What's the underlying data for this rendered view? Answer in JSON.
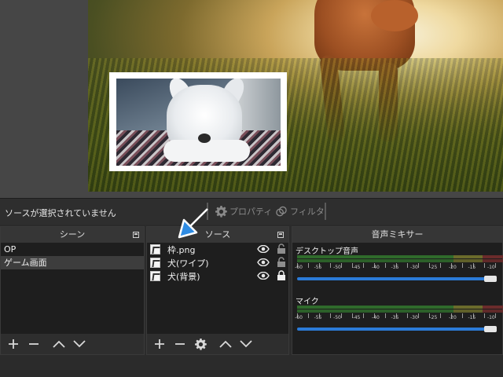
{
  "status": {
    "message": "ソースが選択されていません"
  },
  "toolbar": {
    "properties_label": "プロパティ",
    "filters_label": "フィルタ"
  },
  "scenes": {
    "title": "シーン",
    "items": [
      {
        "label": "OP",
        "selected": false
      },
      {
        "label": "ゲーム画面",
        "selected": true
      }
    ]
  },
  "sources": {
    "title": "ソース",
    "items": [
      {
        "label": "枠.png",
        "visible": true,
        "locked": false
      },
      {
        "label": "犬(ワイプ)",
        "visible": true,
        "locked": false
      },
      {
        "label": "犬(背景)",
        "visible": true,
        "locked": true
      }
    ]
  },
  "mixer": {
    "title": "音声ミキサー",
    "tick_labels": [
      "-60",
      "-55",
      "-50",
      "-45",
      "-40",
      "-35",
      "-30",
      "-25",
      "-20",
      "-15",
      "-10"
    ],
    "channels": [
      {
        "name": "デスクトップ音声",
        "volume": 0.96
      },
      {
        "name": "マイク",
        "volume": 0.96
      }
    ]
  },
  "colors": {
    "accent": "#2b7bd8",
    "arrow": "#2f8ce3",
    "panel_bg": "#1e1e1e",
    "title_bg": "#363636"
  },
  "icons": {
    "add": "plus-icon",
    "remove": "minus-icon",
    "up": "chevron-up-icon",
    "down": "chevron-down-icon",
    "settings": "gear-icon",
    "visibility": "eye-icon",
    "lock": "lock-icon",
    "properties": "gear-icon",
    "filters": "filter-icon",
    "pointer": "arrow-pointer-icon"
  }
}
